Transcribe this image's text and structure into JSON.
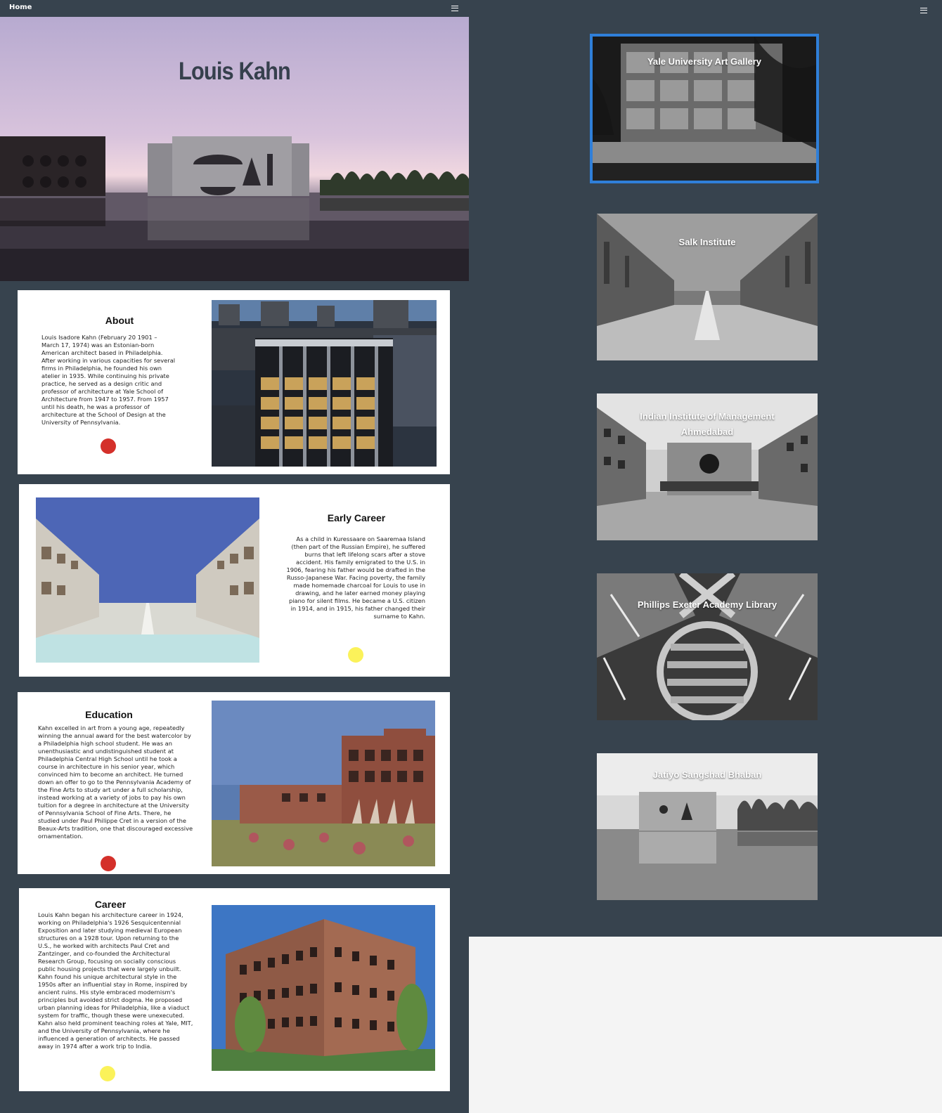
{
  "nav": {
    "home_label": "Home"
  },
  "hero": {
    "title": "Louis Kahn"
  },
  "about": {
    "heading": "About",
    "text": "Louis Isadore Kahn (February 20 1901 – March 17, 1974) was an Estonian-born American architect based in Philadelphia. After working in various capacities for several firms in Philadelphia, he founded his own atelier in 1935. While continuing his private practice, he served as a design critic and professor of architecture at Yale School of Architecture from 1947 to 1957. From 1957 until his death, he was a professor of architecture at the School of Design at the University of Pennsylvania."
  },
  "early_career": {
    "heading": "Early Career",
    "text": "As a child in Kuressaare on Saaremaa Island (then part of the Russian Empire), he suffered burns that left lifelong scars after a stove accident. His family emigrated to the U.S. in 1906, fearing his father would be drafted in the Russo-Japanese War. Facing poverty, the family made homemade charcoal for Louis to use in drawing, and he later earned money playing piano for silent films. He became a U.S. citizen in 1914, and in 1915, his father changed their surname to Kahn."
  },
  "education": {
    "heading": "Education",
    "text": "Kahn excelled in art from a young age, repeatedly winning the annual award for the best watercolor by a Philadelphia high school student. He was an unenthusiastic and undistinguished student at Philadelphia Central High School until he took a course in architecture in his senior year, which convinced him to become an architect. He turned down an offer to go to the Pennsylvania Academy of the Fine Arts to study art under a full scholarship, instead working at a variety of jobs to pay his own tuition for a degree in architecture at the University of Pennsylvania School of Fine Arts. There, he studied under Paul Philippe Cret in a version of the Beaux-Arts tradition, one that discouraged excessive ornamentation."
  },
  "career": {
    "heading": "Career",
    "text": "Louis Kahn began his architecture career in 1924, working on Philadelphia's 1926 Sesquicentennial Exposition and later studying medieval European structures on a 1928 tour. Upon returning to the U.S., he worked with architects Paul Cret and Zantzinger, and co-founded the Architectural Research Group, focusing on socially conscious public housing projects that were largely unbuilt. Kahn found his unique architectural style in the 1950s after an influential stay in Rome, inspired by ancient ruins. His style embraced modernism's principles but avoided strict dogma. He proposed urban planning ideas for Philadelphia, like a viaduct system for traffic, though these were unexecuted. Kahn also held prominent teaching roles at Yale, MIT, and the University of Pennsylvania, where he influenced a generation of architects. He passed away in 1974 after a work trip to India."
  },
  "gallery": [
    {
      "label": "Yale University Art Gallery"
    },
    {
      "label": "Salk Institute"
    },
    {
      "label": "Indian Institute of Management Ahmedabad"
    },
    {
      "label": "Phillips Exeter Academy Library"
    },
    {
      "label": "Jatiyo Sangshad Bhaban"
    }
  ],
  "colors": {
    "panel": "#37434e",
    "accent_red": "#d4302a",
    "accent_yellow": "#fbf25a",
    "selected_border": "#2f7fd9"
  }
}
